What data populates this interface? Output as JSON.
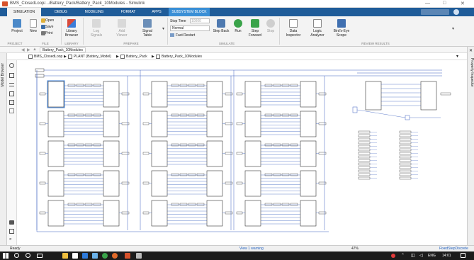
{
  "window": {
    "title": "BMS_ClosedLoop/.../Battery_Pack/Battery_Pack_10Modules - Simulink",
    "controls": [
      "—",
      "□",
      "✕"
    ]
  },
  "tabs": [
    "SIMULATION",
    "DEBUG",
    "MODELING",
    "FORMAT",
    "APPS",
    "SUBSYSTEM BLOCK"
  ],
  "ribbon": {
    "file": {
      "new": "New",
      "open": "Open",
      "save": "Save",
      "print": "Print",
      "project": "Project",
      "group": "FILE"
    },
    "library": {
      "label": "Library Browser",
      "group": "LIBRARY"
    },
    "prepare": {
      "log": "Log Signals",
      "add": "Add Viewer",
      "signal_table": "Signal Table",
      "group": "PREPARE"
    },
    "simulate": {
      "stop_time_label": "Stop Time",
      "stop_time_value": "10000",
      "mode": "Normal",
      "fast_restart": "Fast Restart",
      "step_back": "Step Back",
      "run": "Run",
      "step_forward": "Step Forward",
      "stop": "Stop",
      "group": "SIMULATE"
    },
    "review": {
      "data_inspector": "Data Inspector",
      "logic_analyzer": "Logic Analyzer",
      "birds_eye": "Bird's-Eye Scope",
      "group": "REVIEW RESULTS"
    },
    "project_group": "PROJECT"
  },
  "address": {
    "current": "Battery_Pack_10Modules"
  },
  "breadcrumb": [
    "BMS_ClosedLoop",
    "PLANT (Battery_Model)",
    "Battery_Pack",
    "Battery_Pack_10Modules"
  ],
  "side_labels": {
    "model_browser": "Model Browser",
    "property_inspector": "Property Inspector"
  },
  "status": {
    "left": "Ready",
    "center": "View 1 warning",
    "zoom": "47%",
    "solver": "FixedStepDiscrete"
  },
  "taskbar": {
    "lang": "ENG",
    "time": "14:01"
  },
  "colors": {
    "tabbar": "#1f5c99",
    "subsystem_tab": "#3a8fd6",
    "line": "#3b5fbf",
    "block_border": "#333333"
  }
}
